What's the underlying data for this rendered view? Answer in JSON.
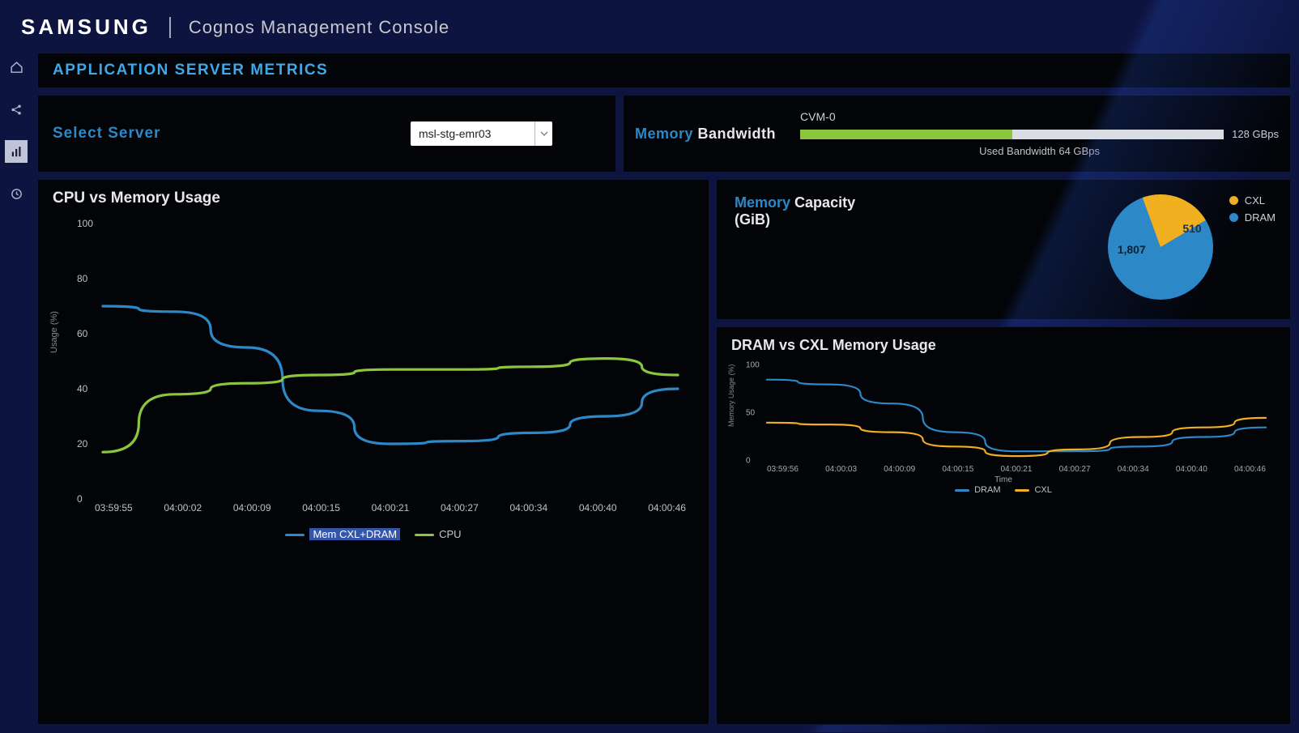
{
  "header": {
    "brand": "SAMSUNG",
    "subtitle": "Cognos Management Console"
  },
  "sidebar": {
    "items": [
      {
        "name": "home-icon"
      },
      {
        "name": "share-icon"
      },
      {
        "name": "chart-icon"
      },
      {
        "name": "clock-icon"
      }
    ],
    "active_index": 2
  },
  "page_title": "APPLICATION SERVER METRICS",
  "select_server": {
    "label": "Select Server",
    "value": "msl-stg-emr03"
  },
  "bandwidth": {
    "title_accent": "Memory",
    "title_rest": "Bandwidth",
    "node": "CVM-0",
    "max_label": "128 GBps",
    "used_label": "Used Bandwidth 64 GBps",
    "used_pct": 50
  },
  "cpu_mem_chart": {
    "title": "CPU vs Memory Usage",
    "ylabel": "Usage (%)",
    "legend": [
      {
        "name": "Mem CXL+DRAM",
        "color": "#2d88c8",
        "highlighted": true
      },
      {
        "name": "CPU",
        "color": "#8cc63f",
        "highlighted": false
      }
    ]
  },
  "pie": {
    "title_accent": "Memory",
    "title_rest": "Capacity",
    "unit": "(GiB)",
    "slices": [
      {
        "name": "CXL",
        "value": 510,
        "color": "#f0b020"
      },
      {
        "name": "DRAM",
        "value": 1807,
        "color": "#2d88c8"
      }
    ]
  },
  "dram_cxl_chart": {
    "title": "DRAM vs CXL Memory Usage",
    "ylabel": "Memory Usage (%)",
    "xlabel": "Time",
    "legend": [
      {
        "name": "DRAM",
        "color": "#2d88c8"
      },
      {
        "name": "CXL",
        "color": "#f0b020"
      }
    ]
  },
  "chart_data": [
    {
      "type": "line",
      "title": "CPU vs Memory Usage",
      "ylabel": "Usage (%)",
      "ylim": [
        0,
        100
      ],
      "categories": [
        "03:59:55",
        "04:00:02",
        "04:00:09",
        "04:00:15",
        "04:00:21",
        "04:00:27",
        "04:00:34",
        "04:00:40",
        "04:00:46"
      ],
      "series": [
        {
          "name": "Mem CXL+DRAM",
          "color": "#2d88c8",
          "values": [
            70,
            68,
            55,
            32,
            20,
            21,
            24,
            30,
            40
          ]
        },
        {
          "name": "CPU",
          "color": "#8cc63f",
          "values": [
            17,
            38,
            42,
            45,
            47,
            47,
            48,
            51,
            45
          ]
        }
      ]
    },
    {
      "type": "pie",
      "title": "Memory Capacity (GiB)",
      "series": [
        {
          "name": "CXL",
          "value": 510,
          "color": "#f0b020"
        },
        {
          "name": "DRAM",
          "value": 1807,
          "color": "#2d88c8"
        }
      ]
    },
    {
      "type": "line",
      "title": "DRAM vs CXL Memory Usage",
      "ylabel": "Memory Usage (%)",
      "xlabel": "Time",
      "ylim": [
        0,
        100
      ],
      "categories": [
        "03:59:56",
        "04:00:03",
        "04:00:09",
        "04:00:15",
        "04:00:21",
        "04:00:27",
        "04:00:34",
        "04:00:40",
        "04:00:46"
      ],
      "series": [
        {
          "name": "DRAM",
          "color": "#2d88c8",
          "values": [
            85,
            80,
            60,
            30,
            10,
            10,
            15,
            25,
            35
          ]
        },
        {
          "name": "CXL",
          "color": "#f0b020",
          "values": [
            40,
            38,
            30,
            15,
            5,
            12,
            25,
            35,
            45
          ]
        }
      ]
    }
  ]
}
